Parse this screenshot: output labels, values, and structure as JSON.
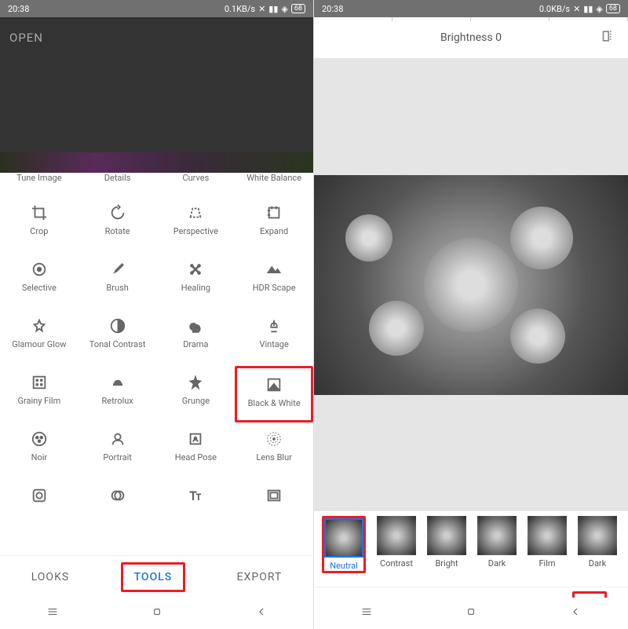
{
  "status": {
    "time": "20:38",
    "left_rate": "0.1KB/s",
    "right_rate": "0.0KB/s",
    "battery": "68"
  },
  "left": {
    "open": "OPEN",
    "tools_row0": [
      "Tune Image",
      "Details",
      "Curves",
      "White Balance"
    ],
    "tools": [
      {
        "id": "crop",
        "label": "Crop"
      },
      {
        "id": "rotate",
        "label": "Rotate"
      },
      {
        "id": "perspective",
        "label": "Perspective"
      },
      {
        "id": "expand",
        "label": "Expand"
      },
      {
        "id": "selective",
        "label": "Selective"
      },
      {
        "id": "brush",
        "label": "Brush"
      },
      {
        "id": "healing",
        "label": "Healing"
      },
      {
        "id": "hdr",
        "label": "HDR Scape"
      },
      {
        "id": "glamour",
        "label": "Glamour Glow"
      },
      {
        "id": "tonal",
        "label": "Tonal Contrast"
      },
      {
        "id": "drama",
        "label": "Drama"
      },
      {
        "id": "vintage",
        "label": "Vintage"
      },
      {
        "id": "grainy",
        "label": "Grainy Film"
      },
      {
        "id": "retrolux",
        "label": "Retrolux"
      },
      {
        "id": "grunge",
        "label": "Grunge"
      },
      {
        "id": "bw",
        "label": "Black & White"
      },
      {
        "id": "noir",
        "label": "Noir"
      },
      {
        "id": "portrait",
        "label": "Portrait"
      },
      {
        "id": "headpose",
        "label": "Head Pose"
      },
      {
        "id": "lensblur",
        "label": "Lens Blur"
      },
      {
        "id": "vignette",
        "label": ""
      },
      {
        "id": "double",
        "label": ""
      },
      {
        "id": "text",
        "label": ""
      },
      {
        "id": "frames",
        "label": ""
      }
    ],
    "tabs": {
      "looks": "LOOKS",
      "tools": "TOOLS",
      "export": "EXPORT"
    }
  },
  "right": {
    "param": "Brightness 0",
    "presets": [
      {
        "id": "neutral",
        "label": "Neutral",
        "sel": true
      },
      {
        "id": "contrast",
        "label": "Contrast"
      },
      {
        "id": "bright",
        "label": "Bright"
      },
      {
        "id": "dark",
        "label": "Dark"
      },
      {
        "id": "film",
        "label": "Film"
      },
      {
        "id": "darker",
        "label": "Dark"
      }
    ]
  }
}
